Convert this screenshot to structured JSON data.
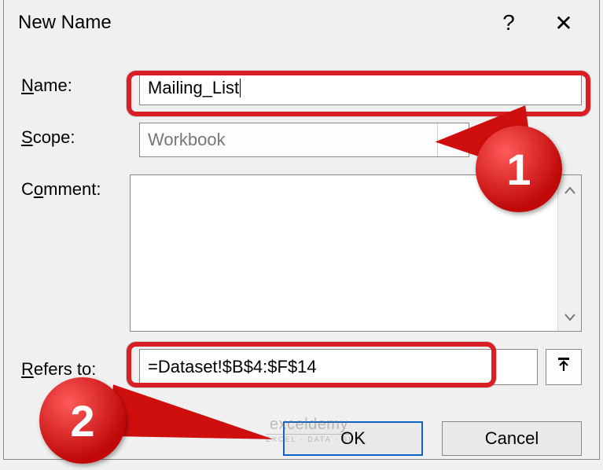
{
  "dialog": {
    "title": "New Name",
    "help_symbol": "?",
    "close_symbol": "✕"
  },
  "fields": {
    "name_label_pre": "N",
    "name_label_rest": "ame:",
    "name_value": "Mailing_List",
    "scope_label_pre": "S",
    "scope_label_rest": "cope:",
    "scope_value": "Workbook",
    "comment_label_pre": "C",
    "comment_label_rest": "omment:",
    "comment_value": "",
    "refers_label_pre": "R",
    "refers_label_rest": "efers to:",
    "refers_value": "=Dataset!$B$4:$F$14"
  },
  "buttons": {
    "ok": "OK",
    "cancel": "Cancel"
  },
  "callouts": {
    "one": "1",
    "two": "2"
  },
  "watermark": {
    "main": "exceldemy",
    "sub": "EXCEL · DATA · BI"
  },
  "icons": {
    "chevron_down": "chevron-down-icon",
    "scroll_up": "chevron-up-icon",
    "scroll_down": "chevron-down-icon",
    "collapse": "collapse-dialog-icon"
  }
}
